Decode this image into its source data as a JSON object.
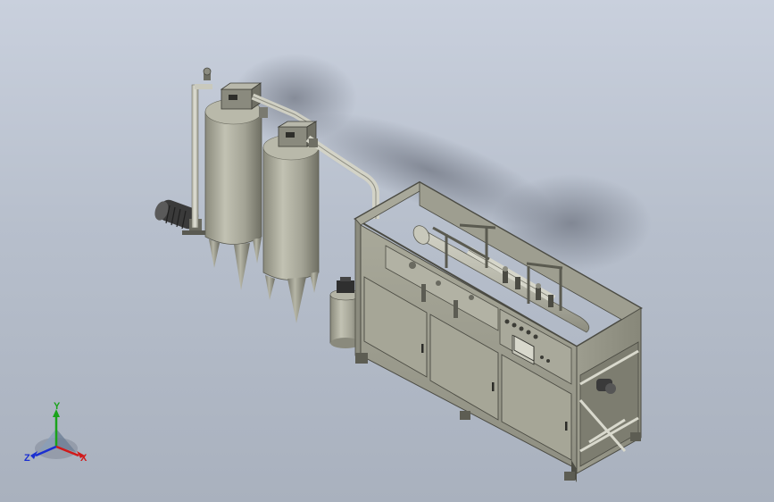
{
  "triad": {
    "x_label": "X",
    "y_label": "Y",
    "z_label": "Z",
    "colors": {
      "x": "#d11a1a",
      "y": "#1aa31a",
      "z": "#1a2fd1"
    }
  }
}
